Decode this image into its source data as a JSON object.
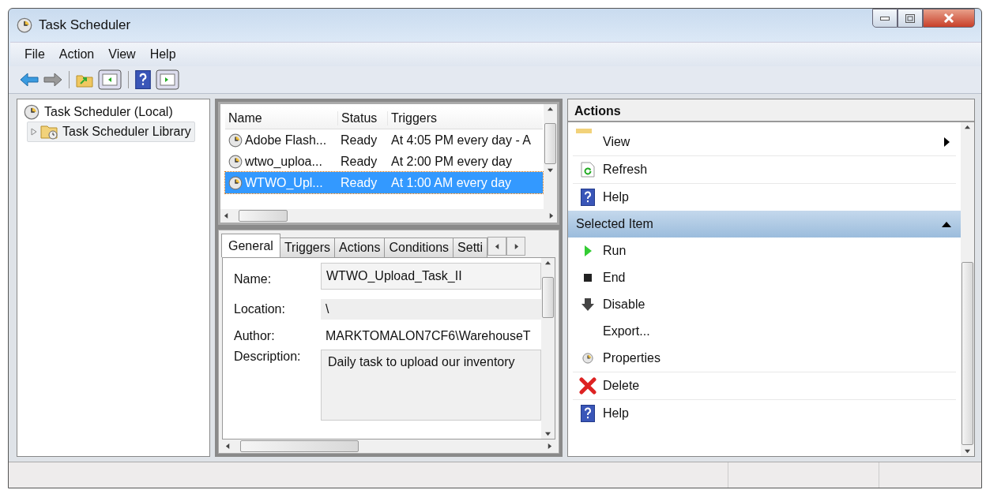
{
  "window": {
    "title": "Task Scheduler"
  },
  "menu": [
    "File",
    "Action",
    "View",
    "Help"
  ],
  "tree": [
    {
      "label": "Task Scheduler (Local)",
      "expanded": true,
      "selected": false,
      "children": [
        {
          "label": "Task Scheduler Library",
          "expanded": false,
          "selected": true
        }
      ]
    }
  ],
  "task_list": {
    "columns": [
      "Name",
      "Status",
      "Triggers"
    ],
    "rows": [
      {
        "name": "Adobe Flash...",
        "status": "Ready",
        "trigger": "At 4:05 PM every day - A",
        "selected": false
      },
      {
        "name": "wtwo_uploa...",
        "status": "Ready",
        "trigger": "At 2:00 PM every day",
        "selected": false
      },
      {
        "name": "WTWO_Upl...",
        "status": "Ready",
        "trigger": "At 1:00 AM every day",
        "selected": true
      }
    ]
  },
  "tabs": [
    {
      "label": "General",
      "selected": true
    },
    {
      "label": "Triggers",
      "selected": false
    },
    {
      "label": "Actions",
      "selected": false
    },
    {
      "label": "Conditions",
      "selected": false
    },
    {
      "label": "Setti",
      "selected": false
    }
  ],
  "general": [
    {
      "label": "Name:",
      "value": "WTWO_Upload_Task_II",
      "kind": "field"
    },
    {
      "label": "Location:",
      "value": "\\",
      "kind": "readonly"
    },
    {
      "label": "Author:",
      "value": "MARKTOMALON7CF6\\WarehouseT",
      "kind": "text"
    },
    {
      "label": "Description:",
      "value": "Daily task to upload our inventory",
      "kind": "textarea"
    }
  ],
  "actions": {
    "title": "Actions",
    "items": [
      {
        "label": "View",
        "kind": "none",
        "submenu": true,
        "divider_below": true
      },
      {
        "label": "Refresh",
        "kind": "refresh",
        "submenu": false,
        "divider_below": true
      },
      {
        "label": "Help",
        "kind": "help",
        "submenu": false,
        "divider_below": false
      }
    ],
    "sections": [
      {
        "title": "Selected Item",
        "expanded": true,
        "items": [
          {
            "label": "Run",
            "kind": "run",
            "submenu": false,
            "divider_below": false
          },
          {
            "label": "End",
            "kind": "end",
            "submenu": false,
            "divider_below": false
          },
          {
            "label": "Disable",
            "kind": "disable",
            "submenu": false,
            "divider_below": false
          },
          {
            "label": "Export...",
            "kind": "none",
            "submenu": false,
            "divider_below": false
          },
          {
            "label": "Properties",
            "kind": "properties",
            "submenu": false,
            "divider_below": true
          },
          {
            "label": "Delete",
            "kind": "delete",
            "submenu": false,
            "divider_below": true
          },
          {
            "label": "Help",
            "kind": "help",
            "submenu": false,
            "divider_below": false
          }
        ]
      }
    ]
  }
}
